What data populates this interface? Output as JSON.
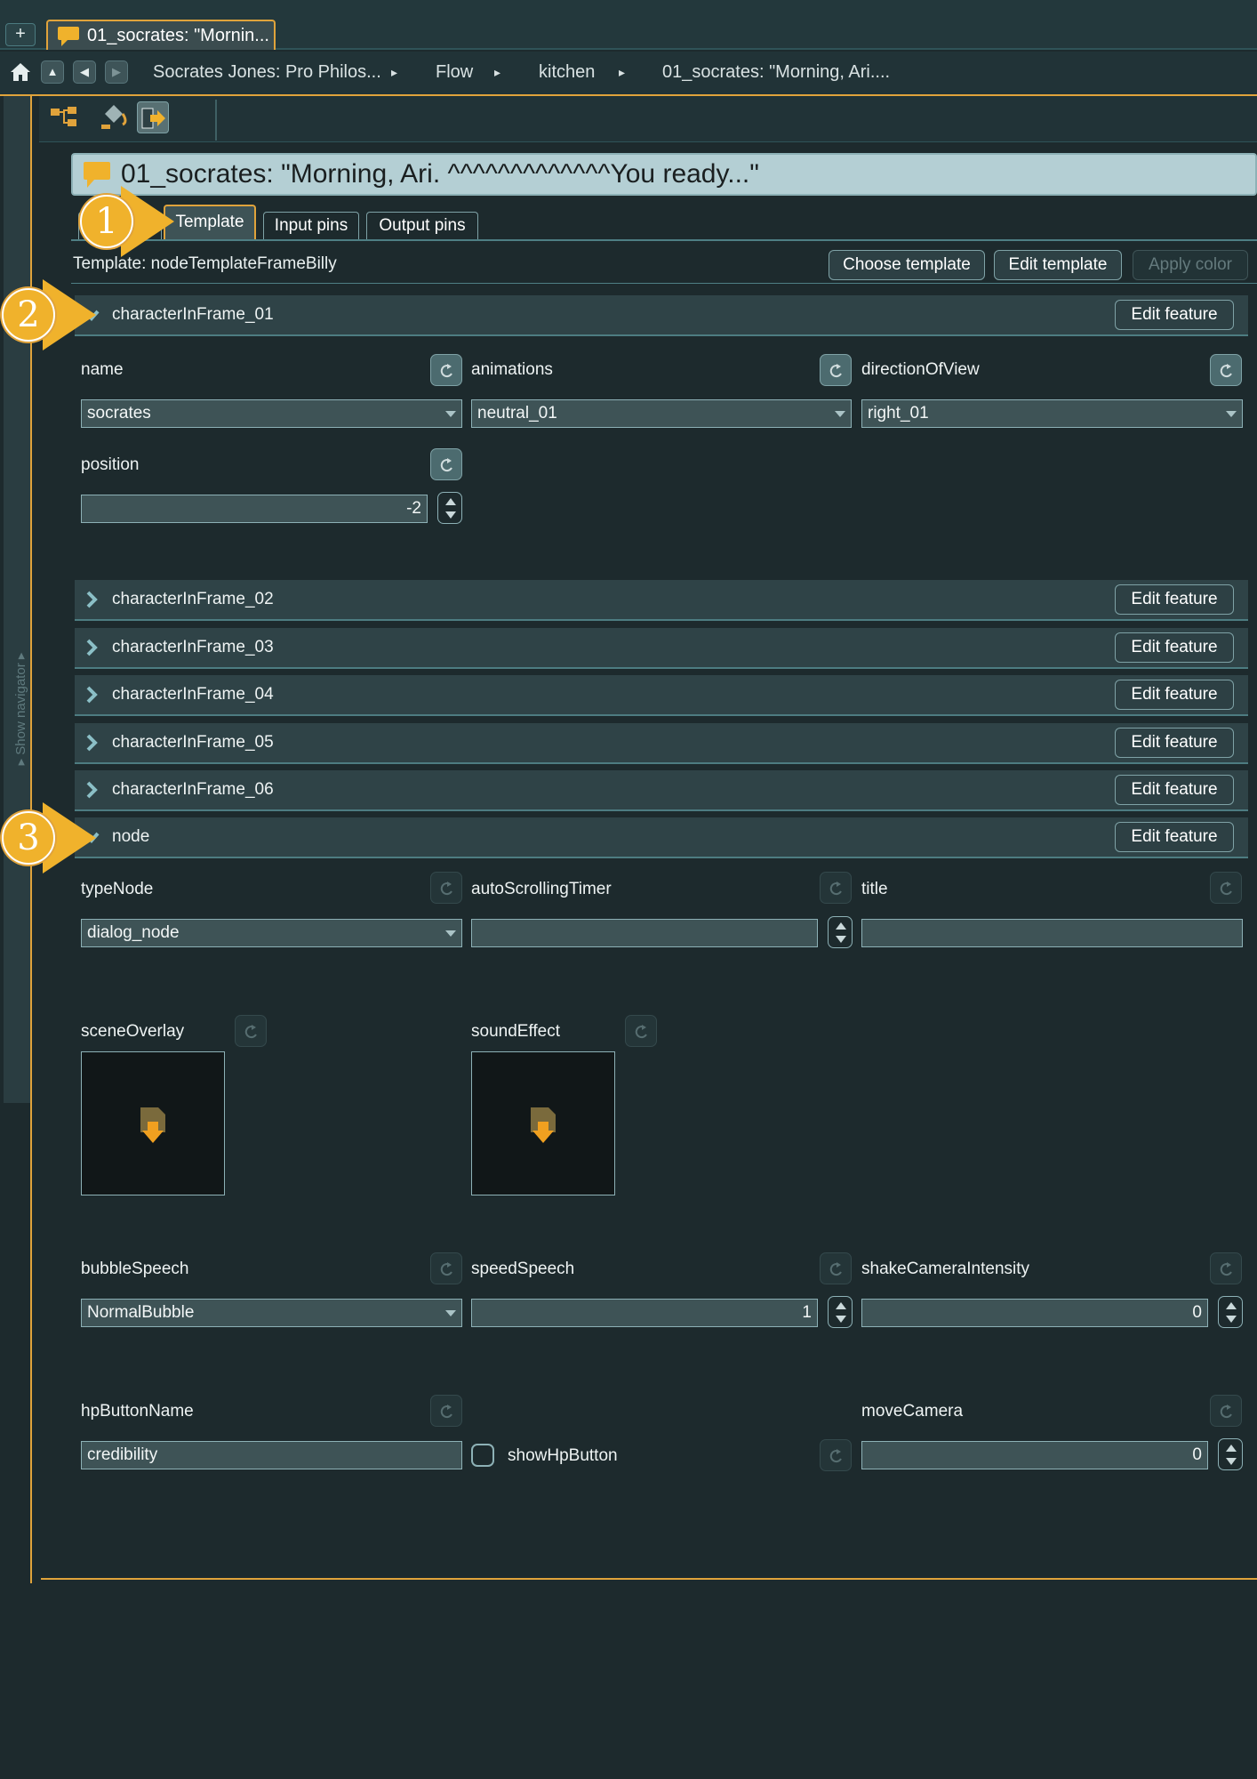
{
  "tabstrip": {
    "add_label": "+",
    "doc_tab_label": "01_socrates: \"Mornin..."
  },
  "breadcrumb": {
    "items": [
      "Socrates Jones: Pro Philos...",
      "Flow",
      "kitchen",
      "01_socrates: \"Morning, Ari...."
    ],
    "separator": "▸"
  },
  "navigator": {
    "label": "▸ Show navigator ▸"
  },
  "node": {
    "title": "01_socrates: \"Morning, Ari. ^^^^^^^^^^^^^You ready...\""
  },
  "tabs": [
    {
      "label": "Template"
    },
    {
      "label": "Input pins"
    },
    {
      "label": "Output pins"
    }
  ],
  "template": {
    "label": "Template: nodeTemplateFrameBilly",
    "choose_label": "Choose template",
    "edit_label": "Edit template",
    "apply_color_label": "Apply color"
  },
  "edit_feature_label": "Edit feature",
  "features": [
    {
      "name": "characterInFrame_01",
      "expanded": true
    },
    {
      "name": "characterInFrame_02",
      "expanded": false
    },
    {
      "name": "characterInFrame_03",
      "expanded": false
    },
    {
      "name": "characterInFrame_04",
      "expanded": false
    },
    {
      "name": "characterInFrame_05",
      "expanded": false
    },
    {
      "name": "characterInFrame_06",
      "expanded": false
    },
    {
      "name": "node",
      "expanded": true
    }
  ],
  "character": {
    "name_label": "name",
    "name_value": "socrates",
    "animations_label": "animations",
    "animations_value": "neutral_01",
    "direction_label": "directionOfView",
    "direction_value": "right_01",
    "position_label": "position",
    "position_value": "-2"
  },
  "nodeprops": {
    "typeNode_label": "typeNode",
    "typeNode_value": "dialog_node",
    "autoScrollingTimer_label": "autoScrollingTimer",
    "autoScrollingTimer_value": "",
    "title_label": "title",
    "title_value": "",
    "sceneOverlay_label": "sceneOverlay",
    "soundEffect_label": "soundEffect",
    "bubbleSpeech_label": "bubbleSpeech",
    "bubbleSpeech_value": "NormalBubble",
    "speedSpeech_label": "speedSpeech",
    "speedSpeech_value": "1",
    "shakeCamera_label": "shakeCameraIntensity",
    "shakeCamera_value": "0",
    "hpButtonName_label": "hpButtonName",
    "hpButtonName_value": "credibility",
    "showHpButton_label": "showHpButton",
    "showHpButton_checked": false,
    "moveCamera_label": "moveCamera",
    "moveCamera_value": "0"
  },
  "badges": [
    "1",
    "2",
    "3"
  ],
  "colors": {
    "accent": "#e0a33b",
    "badge": "#f0b22c",
    "panel": "#1d2a2d",
    "title_bar": "#b4cfd4"
  }
}
